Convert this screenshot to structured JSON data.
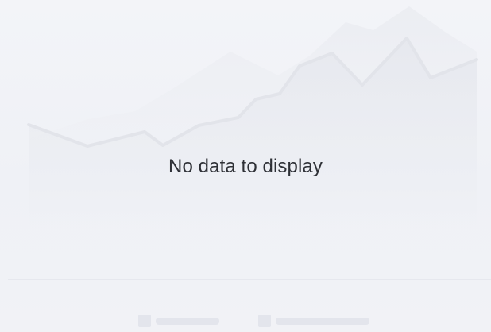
{
  "empty_state": {
    "message": "No data to display"
  },
  "placeholder": {
    "colors": {
      "background": "#f1f2f6",
      "line": "#e2e4ea",
      "area": "#e6e8ee",
      "back_area": "#eceef3",
      "legend": "#e3e5ec",
      "text": "#2e3036"
    }
  }
}
